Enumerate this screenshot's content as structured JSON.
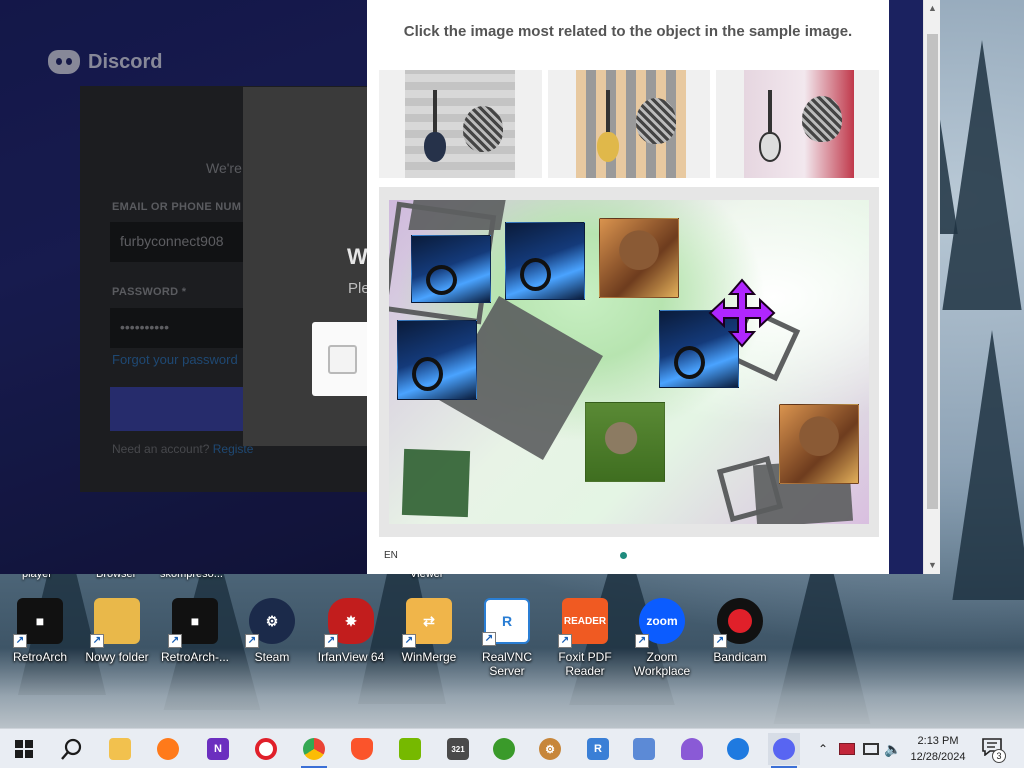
{
  "discord": {
    "brand": "Discord",
    "subtitle": "We're",
    "email_label": "EMAIL OR PHONE NUM",
    "email_value": "furbyconnect908",
    "password_label": "PASSWORD *",
    "password_value": "••••••••••",
    "forgot_link": "Forgot your password",
    "need_account": "Need an account?",
    "register_link": "Registe",
    "modal_heading": "W",
    "modal_sub": "Ple"
  },
  "captcha": {
    "instruction": "Click the image most related to the object in the sample image.",
    "language": "EN"
  },
  "desktop": {
    "top_labels": [
      "player",
      "Browser",
      "skompreso...",
      "Viewer"
    ],
    "icons": [
      {
        "label": "RetroArch",
        "icon": "retroarch-icon",
        "color": "#111111"
      },
      {
        "label": "Nowy folder",
        "icon": "folder-icon",
        "color": "#e9b84a"
      },
      {
        "label": "RetroArch-...",
        "icon": "retroarch-admin-icon",
        "color": "#111111"
      },
      {
        "label": "Steam",
        "icon": "steam-icon",
        "color": "#1b2a4a"
      },
      {
        "label": "IrfanView 64",
        "icon": "irfanview-icon",
        "color": "#c21d1d"
      },
      {
        "label": "WinMerge",
        "icon": "winmerge-icon",
        "color": "#f0b54a"
      },
      {
        "label": "RealVNC Server",
        "icon": "realvnc-icon",
        "color": "#2a7ed4"
      },
      {
        "label": "Foxit PDF Reader",
        "icon": "foxit-icon",
        "color": "#f05a22"
      },
      {
        "label": "Zoom Workplace",
        "icon": "zoom-icon",
        "color": "#0b5cff"
      },
      {
        "label": "Bandicam",
        "icon": "bandicam-icon",
        "color": "#111111"
      }
    ],
    "icon_texts": {
      "foxit": "READER",
      "zoom": "zoom"
    }
  },
  "taskbar": {
    "items": [
      {
        "name": "start-button",
        "color": "#1b1b1b"
      },
      {
        "name": "search-icon",
        "color": "#1b1b1b"
      },
      {
        "name": "file-explorer-icon",
        "color": "#f2c14e"
      },
      {
        "name": "firefox-icon",
        "color": "#ff7a1a"
      },
      {
        "name": "app-n-icon",
        "color": "#6b2fbf"
      },
      {
        "name": "opera-icon",
        "color": "#e0202a"
      },
      {
        "name": "chrome-icon",
        "color": "#34a853"
      },
      {
        "name": "brave-icon",
        "color": "#fb542b"
      },
      {
        "name": "nvidia-icon",
        "color": "#76b900"
      },
      {
        "name": "calculator-icon",
        "color": "#4a4a4a"
      },
      {
        "name": "pea-app-icon",
        "color": "#3a9a2a"
      },
      {
        "name": "settings-gear-icon",
        "color": "#c7863a"
      },
      {
        "name": "remote-desktop-icon",
        "color": "#3a7fd6"
      },
      {
        "name": "network-tool-icon",
        "color": "#5c8ad6"
      },
      {
        "name": "ghost-app-icon",
        "color": "#8a5ad6"
      },
      {
        "name": "edge-icon",
        "color": "#1f7ae0"
      },
      {
        "name": "discord-taskbar-icon",
        "color": "#5865f2"
      }
    ],
    "calc_text": "321",
    "time": "2:13 PM",
    "date": "12/28/2024",
    "notification_count": "3"
  }
}
